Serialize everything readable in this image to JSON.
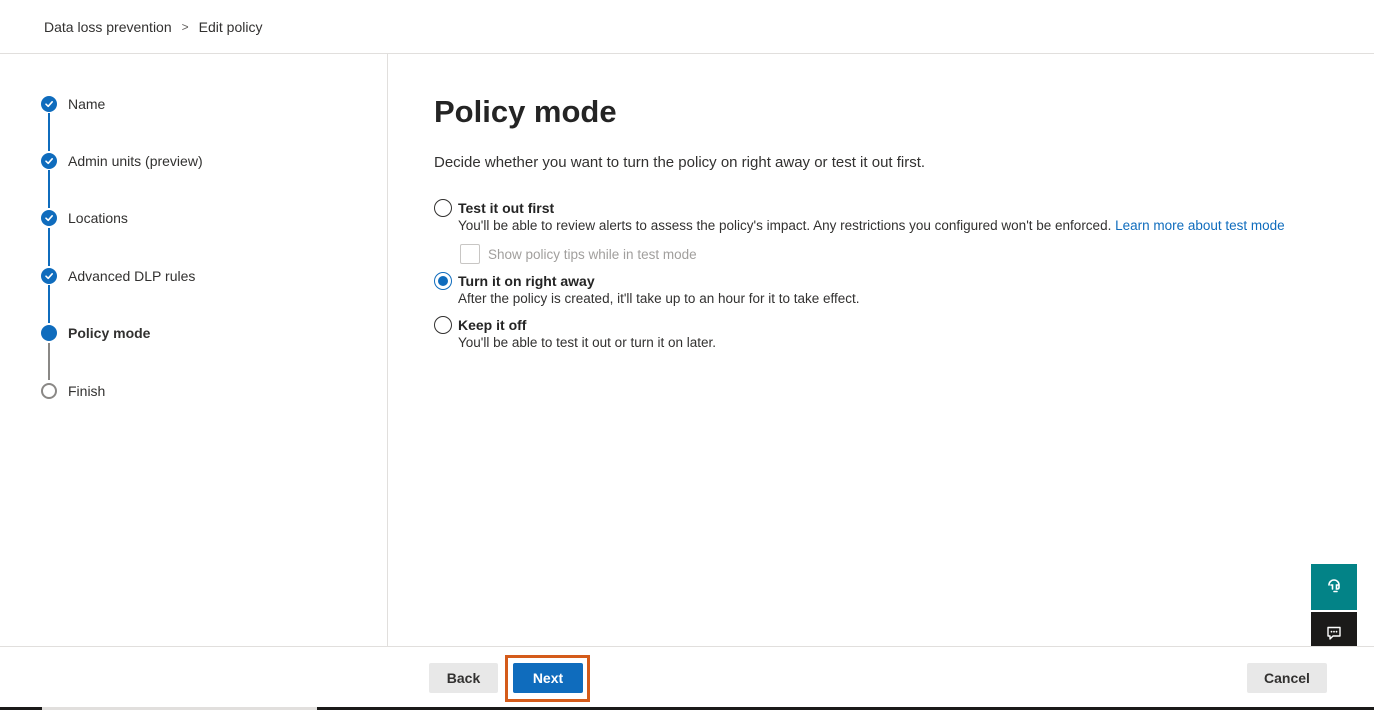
{
  "breadcrumb": {
    "root": "Data loss prevention",
    "separator": ">",
    "current": "Edit policy"
  },
  "steps": [
    {
      "label": "Name",
      "state": "done"
    },
    {
      "label": "Admin units (preview)",
      "state": "done"
    },
    {
      "label": "Locations",
      "state": "done"
    },
    {
      "label": "Advanced DLP rules",
      "state": "done"
    },
    {
      "label": "Policy mode",
      "state": "current"
    },
    {
      "label": "Finish",
      "state": "pending"
    }
  ],
  "main": {
    "title": "Policy mode",
    "description": "Decide whether you want to turn the policy on right away or test it out first.",
    "options": [
      {
        "label": "Test it out first",
        "description": "You'll be able to review alerts to assess the policy's impact. Any restrictions you configured won't be enforced.",
        "link": "Learn more about test mode",
        "selected": false
      },
      {
        "label": "Turn it on right away",
        "description": "After the policy is created, it'll take up to an hour for it to take effect.",
        "selected": true
      },
      {
        "label": "Keep it off",
        "description": "You'll be able to test it out or turn it on later.",
        "selected": false
      }
    ],
    "checkbox": {
      "label": "Show policy tips while in test mode",
      "checked": false,
      "disabled": true
    }
  },
  "footer": {
    "back_label": "Back",
    "next_label": "Next",
    "cancel_label": "Cancel"
  },
  "side_buttons": {
    "help_icon": "headset-help-icon",
    "feedback_icon": "feedback-chat-icon"
  },
  "colors": {
    "accent": "#0f6cbd",
    "highlight_outline": "#d45b1a",
    "help_button": "#038387",
    "feedback_button": "#1b1a19"
  }
}
